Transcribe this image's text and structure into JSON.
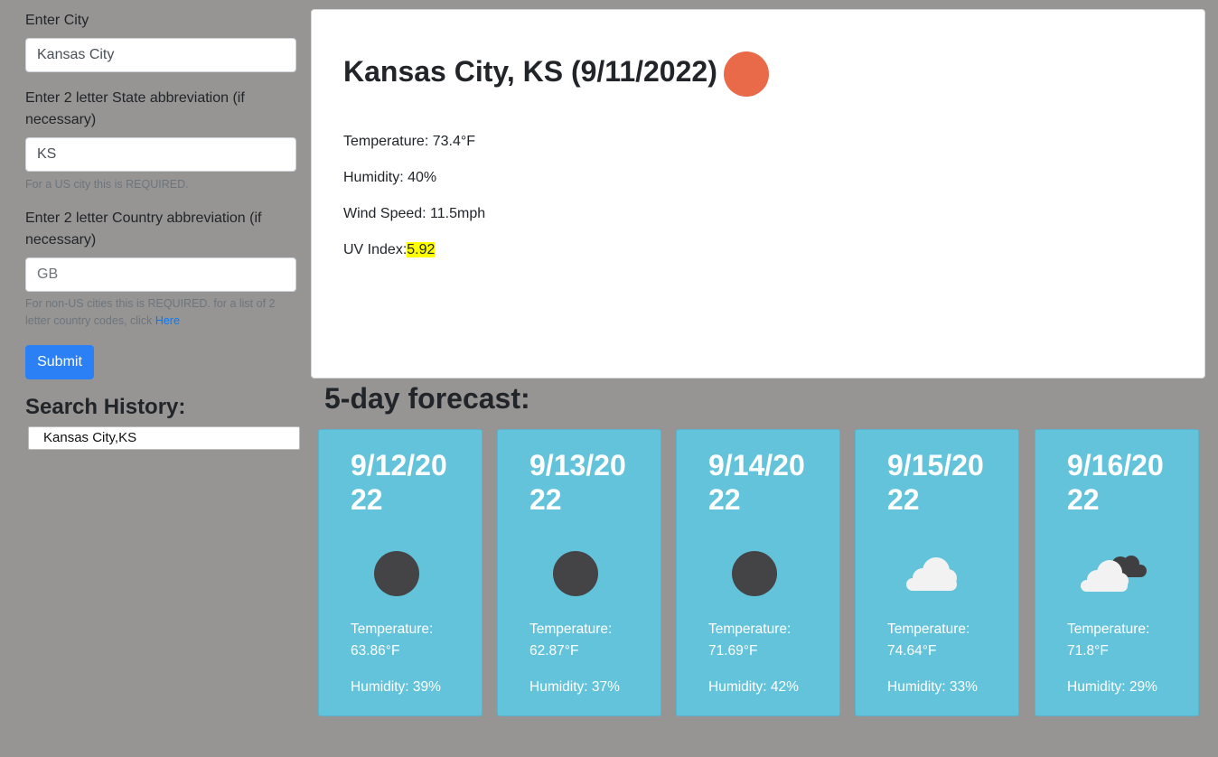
{
  "form": {
    "city_label": "Enter City",
    "city_value": "Kansas City",
    "state_label": "Enter 2 letter State abbreviation (if necessary)",
    "state_value": "KS",
    "state_help": "For a US city this is REQUIRED.",
    "country_label": "Enter 2 letter Country abbreviation (if necessary)",
    "country_placeholder": "GB",
    "country_help": "For non-US cities this is REQUIRED. for a list of 2 letter country codes, click",
    "country_help_link": "Here",
    "submit_label": "Submit"
  },
  "history": {
    "title": "Search History:",
    "items": [
      "Kansas City,KS"
    ]
  },
  "current": {
    "title": "Kansas City, KS (9/11/2022)",
    "icon": "sun-icon",
    "icon_color": "#e96a48",
    "temperature": "Temperature: 73.4°F",
    "humidity": "Humidity: 40%",
    "wind": "Wind Speed: 11.5mph",
    "uv_label": "UV Index:",
    "uv_value": "5.92",
    "uv_color": "#ffff00"
  },
  "forecast": {
    "title": "5-day forecast:",
    "card_color": "#62c3db",
    "days": [
      {
        "date": "9/12/2022",
        "icon": "moon-icon",
        "temperature": "Temperature: 63.86°F",
        "humidity": "Humidity: 39%"
      },
      {
        "date": "9/13/2022",
        "icon": "moon-icon",
        "temperature": "Temperature: 62.87°F",
        "humidity": "Humidity: 37%"
      },
      {
        "date": "9/14/2022",
        "icon": "moon-icon",
        "temperature": "Temperature: 71.69°F",
        "humidity": "Humidity: 42%"
      },
      {
        "date": "9/15/2022",
        "icon": "cloud-icon",
        "temperature": "Temperature: 74.64°F",
        "humidity": "Humidity: 33%"
      },
      {
        "date": "9/16/2022",
        "icon": "broken-clouds-icon",
        "temperature": "Temperature: 71.8°F",
        "humidity": "Humidity: 29%"
      }
    ]
  }
}
